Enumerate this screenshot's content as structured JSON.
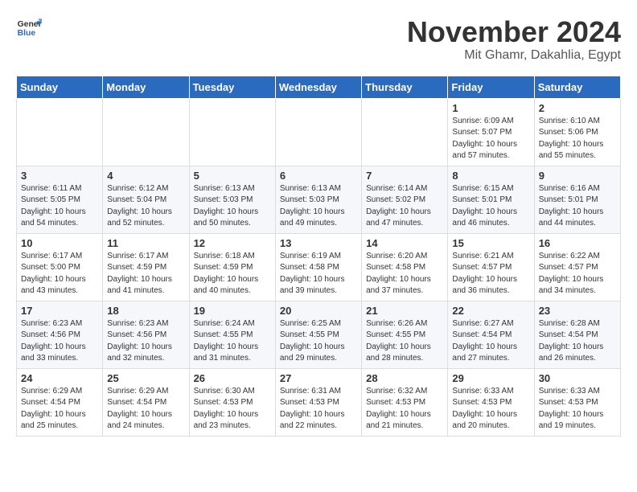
{
  "header": {
    "logo_line1": "General",
    "logo_line2": "Blue",
    "month": "November 2024",
    "location": "Mit Ghamr, Dakahlia, Egypt"
  },
  "weekdays": [
    "Sunday",
    "Monday",
    "Tuesday",
    "Wednesday",
    "Thursday",
    "Friday",
    "Saturday"
  ],
  "weeks": [
    [
      {
        "day": "",
        "info": ""
      },
      {
        "day": "",
        "info": ""
      },
      {
        "day": "",
        "info": ""
      },
      {
        "day": "",
        "info": ""
      },
      {
        "day": "",
        "info": ""
      },
      {
        "day": "1",
        "info": "Sunrise: 6:09 AM\nSunset: 5:07 PM\nDaylight: 10 hours and 57 minutes."
      },
      {
        "day": "2",
        "info": "Sunrise: 6:10 AM\nSunset: 5:06 PM\nDaylight: 10 hours and 55 minutes."
      }
    ],
    [
      {
        "day": "3",
        "info": "Sunrise: 6:11 AM\nSunset: 5:05 PM\nDaylight: 10 hours and 54 minutes."
      },
      {
        "day": "4",
        "info": "Sunrise: 6:12 AM\nSunset: 5:04 PM\nDaylight: 10 hours and 52 minutes."
      },
      {
        "day": "5",
        "info": "Sunrise: 6:13 AM\nSunset: 5:03 PM\nDaylight: 10 hours and 50 minutes."
      },
      {
        "day": "6",
        "info": "Sunrise: 6:13 AM\nSunset: 5:03 PM\nDaylight: 10 hours and 49 minutes."
      },
      {
        "day": "7",
        "info": "Sunrise: 6:14 AM\nSunset: 5:02 PM\nDaylight: 10 hours and 47 minutes."
      },
      {
        "day": "8",
        "info": "Sunrise: 6:15 AM\nSunset: 5:01 PM\nDaylight: 10 hours and 46 minutes."
      },
      {
        "day": "9",
        "info": "Sunrise: 6:16 AM\nSunset: 5:01 PM\nDaylight: 10 hours and 44 minutes."
      }
    ],
    [
      {
        "day": "10",
        "info": "Sunrise: 6:17 AM\nSunset: 5:00 PM\nDaylight: 10 hours and 43 minutes."
      },
      {
        "day": "11",
        "info": "Sunrise: 6:17 AM\nSunset: 4:59 PM\nDaylight: 10 hours and 41 minutes."
      },
      {
        "day": "12",
        "info": "Sunrise: 6:18 AM\nSunset: 4:59 PM\nDaylight: 10 hours and 40 minutes."
      },
      {
        "day": "13",
        "info": "Sunrise: 6:19 AM\nSunset: 4:58 PM\nDaylight: 10 hours and 39 minutes."
      },
      {
        "day": "14",
        "info": "Sunrise: 6:20 AM\nSunset: 4:58 PM\nDaylight: 10 hours and 37 minutes."
      },
      {
        "day": "15",
        "info": "Sunrise: 6:21 AM\nSunset: 4:57 PM\nDaylight: 10 hours and 36 minutes."
      },
      {
        "day": "16",
        "info": "Sunrise: 6:22 AM\nSunset: 4:57 PM\nDaylight: 10 hours and 34 minutes."
      }
    ],
    [
      {
        "day": "17",
        "info": "Sunrise: 6:23 AM\nSunset: 4:56 PM\nDaylight: 10 hours and 33 minutes."
      },
      {
        "day": "18",
        "info": "Sunrise: 6:23 AM\nSunset: 4:56 PM\nDaylight: 10 hours and 32 minutes."
      },
      {
        "day": "19",
        "info": "Sunrise: 6:24 AM\nSunset: 4:55 PM\nDaylight: 10 hours and 31 minutes."
      },
      {
        "day": "20",
        "info": "Sunrise: 6:25 AM\nSunset: 4:55 PM\nDaylight: 10 hours and 29 minutes."
      },
      {
        "day": "21",
        "info": "Sunrise: 6:26 AM\nSunset: 4:55 PM\nDaylight: 10 hours and 28 minutes."
      },
      {
        "day": "22",
        "info": "Sunrise: 6:27 AM\nSunset: 4:54 PM\nDaylight: 10 hours and 27 minutes."
      },
      {
        "day": "23",
        "info": "Sunrise: 6:28 AM\nSunset: 4:54 PM\nDaylight: 10 hours and 26 minutes."
      }
    ],
    [
      {
        "day": "24",
        "info": "Sunrise: 6:29 AM\nSunset: 4:54 PM\nDaylight: 10 hours and 25 minutes."
      },
      {
        "day": "25",
        "info": "Sunrise: 6:29 AM\nSunset: 4:54 PM\nDaylight: 10 hours and 24 minutes."
      },
      {
        "day": "26",
        "info": "Sunrise: 6:30 AM\nSunset: 4:53 PM\nDaylight: 10 hours and 23 minutes."
      },
      {
        "day": "27",
        "info": "Sunrise: 6:31 AM\nSunset: 4:53 PM\nDaylight: 10 hours and 22 minutes."
      },
      {
        "day": "28",
        "info": "Sunrise: 6:32 AM\nSunset: 4:53 PM\nDaylight: 10 hours and 21 minutes."
      },
      {
        "day": "29",
        "info": "Sunrise: 6:33 AM\nSunset: 4:53 PM\nDaylight: 10 hours and 20 minutes."
      },
      {
        "day": "30",
        "info": "Sunrise: 6:33 AM\nSunset: 4:53 PM\nDaylight: 10 hours and 19 minutes."
      }
    ]
  ]
}
